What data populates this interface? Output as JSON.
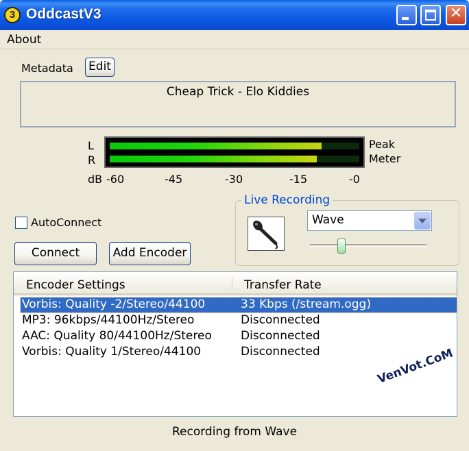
{
  "window": {
    "title": "OddcastV3",
    "app_icon_glyph": "3"
  },
  "menu": {
    "about": "About"
  },
  "metadata": {
    "label": "Metadata",
    "edit_label": "Edit",
    "text": "Cheap Trick - Elo Kiddies"
  },
  "meter": {
    "left_label": "L",
    "right_label": "R",
    "db_label": "dB",
    "ticks": [
      "-60",
      "-45",
      "-30",
      "-15",
      "-0"
    ],
    "peak_label": "Peak",
    "meter_label": "Meter",
    "left_level": 0.85,
    "right_level": 0.83
  },
  "controls": {
    "autoconnect_label": "AutoConnect",
    "autoconnect_checked": false,
    "connect_label": "Connect",
    "add_encoder_label": "Add Encoder"
  },
  "live_recording": {
    "title": "Live Recording",
    "source": "Wave",
    "volume": 0.25,
    "icon": "microphone-icon"
  },
  "encoders": {
    "headers": [
      "Encoder Settings",
      "Transfer Rate"
    ],
    "rows": [
      {
        "settings": "Vorbis: Quality -2/Stereo/44100",
        "rate": "33 Kbps (/stream.ogg)",
        "selected": true
      },
      {
        "settings": "MP3: 96kbps/44100Hz/Stereo",
        "rate": "Disconnected",
        "selected": false
      },
      {
        "settings": "AAC: Quality 80/44100Hz/Stereo",
        "rate": "Disconnected",
        "selected": false
      },
      {
        "settings": "Vorbis: Quality 1/Stereo/44100",
        "rate": "Disconnected",
        "selected": false
      }
    ]
  },
  "watermark": "VenVot.CoM",
  "status": "Recording from Wave",
  "colors": {
    "titlebar": "#0A5FE6",
    "selection": "#316AC5",
    "group_title": "#0046D5",
    "meter_green": "#22D40C"
  }
}
